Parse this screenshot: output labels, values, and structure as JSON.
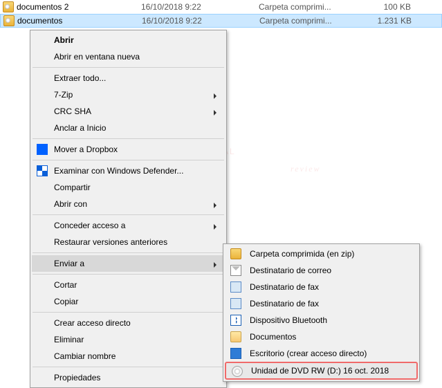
{
  "files": [
    {
      "name": "documentos 2",
      "date": "16/10/2018 9:22",
      "type": "Carpeta comprimi...",
      "size": "100 KB"
    },
    {
      "name": "documentos",
      "date": "16/10/2018 9:22",
      "type": "Carpeta comprimi...",
      "size": "1.231 KB"
    }
  ],
  "menu": {
    "open": "Abrir",
    "open_new": "Abrir en ventana nueva",
    "extract": "Extraer todo...",
    "sevenzip": "7-Zip",
    "crc": "CRC SHA",
    "pin": "Anclar a Inicio",
    "dropbox": "Mover a Dropbox",
    "defender": "Examinar con Windows Defender...",
    "share": "Compartir",
    "open_with": "Abrir con",
    "grant": "Conceder acceso a",
    "restore": "Restaurar versiones anteriores",
    "sendto": "Enviar a",
    "cut": "Cortar",
    "copy": "Copiar",
    "shortcut": "Crear acceso directo",
    "delete": "Eliminar",
    "rename": "Cambiar nombre",
    "properties": "Propiedades"
  },
  "submenu": {
    "zip": "Carpeta comprimida (en zip)",
    "mail": "Destinatario de correo",
    "fax1": "Destinatario de fax",
    "fax2": "Destinatario de fax",
    "bt": "Dispositivo Bluetooth",
    "docs": "Documentos",
    "desktop": "Escritorio (crear acceso directo)",
    "dvd": "Unidad de DVD RW (D:) 16 oct. 2018"
  },
  "watermark": {
    "l1": "ONAL",
    "l2": "review"
  }
}
